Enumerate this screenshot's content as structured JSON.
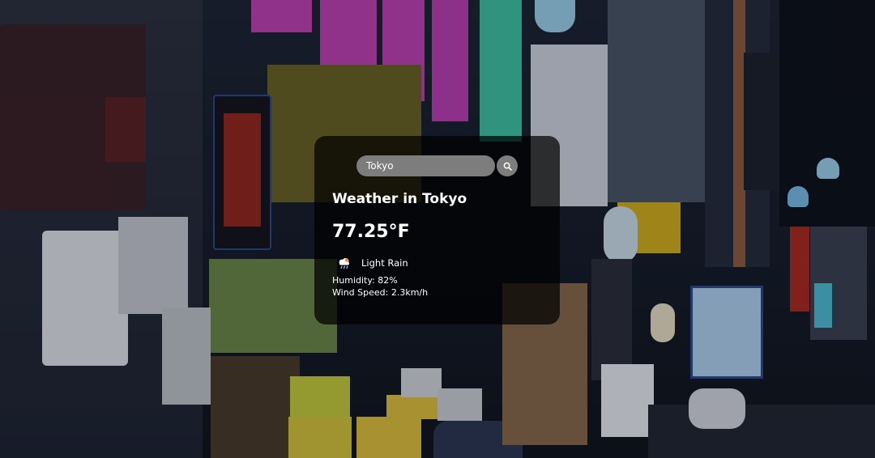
{
  "search": {
    "value": "Tokyo",
    "icon": "search-icon"
  },
  "weather": {
    "title": "Weather in Tokyo",
    "temperature": "77.25°F",
    "condition_icon": "cloud-rain-icon",
    "condition": "Light Rain",
    "humidity": "Humidity: 82%",
    "wind": "Wind Speed: 2.3km/h"
  },
  "colors": {
    "card_background": "#000000b8",
    "input_background": "#7d7d7d",
    "text": "#ffffff"
  }
}
